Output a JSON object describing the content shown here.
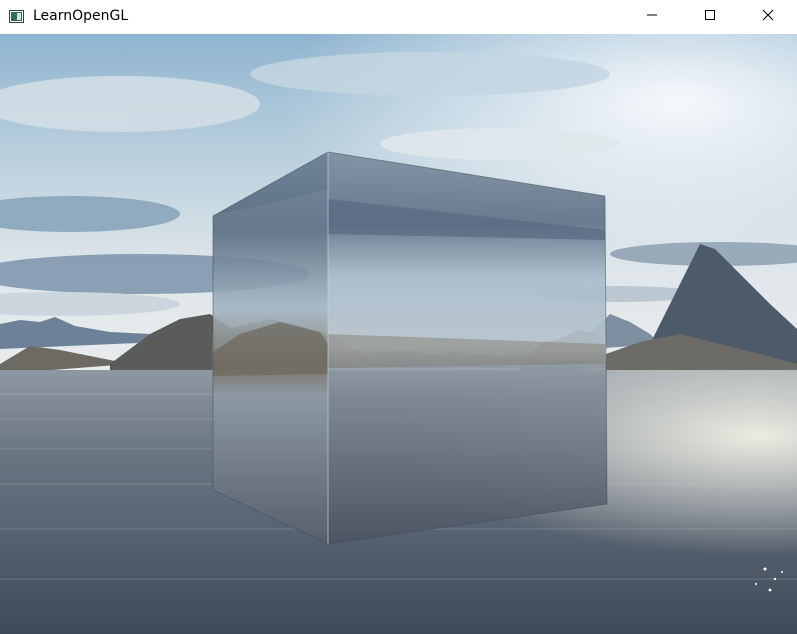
{
  "window": {
    "title": "LearnOpenGL",
    "app_icon": "opengl-window-icon",
    "controls": {
      "minimize_icon": "minimize-icon",
      "maximize_icon": "maximize-icon",
      "close_icon": "close-icon"
    }
  },
  "scene": {
    "subject": "reflective-glass-cube",
    "environment": "skybox-lake-mountains",
    "colors": {
      "sky_top": "#7fa9c6",
      "sky_bright": "#e8edf0",
      "cloud_dark": "#6f8aa3",
      "mountain": "#5f5c56",
      "mountain_far": "#6a7f96",
      "water_dark": "#3b4655",
      "water_light": "#9aa6b0"
    }
  }
}
